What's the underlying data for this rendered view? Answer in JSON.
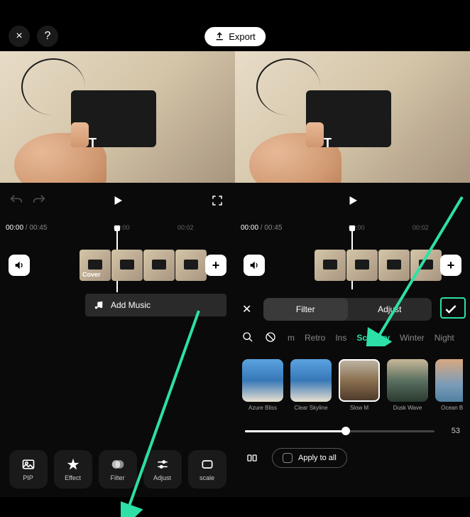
{
  "header": {
    "close": "×",
    "help": "?",
    "export_label": "Export"
  },
  "left": {
    "time_current": "00:00",
    "time_total": "00:45",
    "ticks": {
      "t1": "00:00",
      "t2": "00:02"
    },
    "cover_label": "Cover",
    "add_music_label": "Add Music",
    "tools": {
      "pip": "PIP",
      "effect": "Effect",
      "filter": "Filter",
      "adjust": "Adjust",
      "scale": "scale"
    }
  },
  "right": {
    "time_current": "00:00",
    "time_total": "00:45",
    "ticks": {
      "t1": "00:00",
      "t2": "00:02"
    },
    "panel": {
      "tab_filter": "Filter",
      "tab_adjust": "Adjust",
      "categories": {
        "c0": "m",
        "c1": "Retro",
        "c2": "Ins",
        "c3": "Scenery",
        "c4": "Winter",
        "c5": "Night"
      },
      "filters": {
        "f0": "Azure Bliss",
        "f1": "Clear Skyline",
        "f2": "Slow   M",
        "f3": "Dusk Wave",
        "f4": "Ocean Blue"
      },
      "slider_value": "53",
      "apply_label": "Apply to all"
    }
  }
}
